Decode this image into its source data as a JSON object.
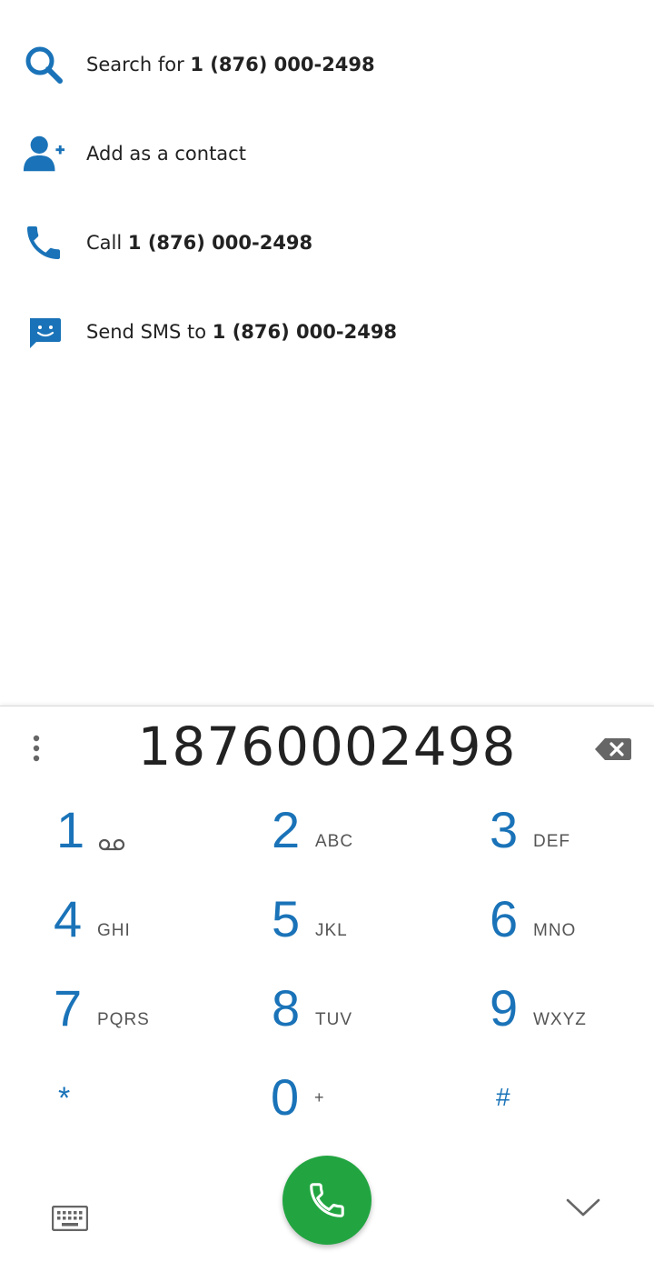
{
  "suggestions": {
    "search": {
      "prefix": "Search for ",
      "number": "1 (876) 000-2498"
    },
    "add_contact": {
      "label": "Add as a contact"
    },
    "call": {
      "prefix": "Call ",
      "number": "1 (876) 000-2498"
    },
    "sms": {
      "prefix": "Send SMS to ",
      "number": "1 (876) 000-2498"
    }
  },
  "dialpad": {
    "digits": "18760002498",
    "keys": [
      {
        "num": "1",
        "letters": ""
      },
      {
        "num": "2",
        "letters": "ABC"
      },
      {
        "num": "3",
        "letters": "DEF"
      },
      {
        "num": "4",
        "letters": "GHI"
      },
      {
        "num": "5",
        "letters": "JKL"
      },
      {
        "num": "6",
        "letters": "MNO"
      },
      {
        "num": "7",
        "letters": "PQRS"
      },
      {
        "num": "8",
        "letters": "TUV"
      },
      {
        "num": "9",
        "letters": "WXYZ"
      },
      {
        "num": "*",
        "letters": ""
      },
      {
        "num": "0",
        "letters": "+"
      },
      {
        "num": "#",
        "letters": ""
      }
    ]
  },
  "colors": {
    "accent": "#1a73b8",
    "call_button": "#22a541",
    "text": "#222222",
    "letters": "#555555"
  },
  "icons": {
    "search": "search-icon",
    "add_contact": "add-person-icon",
    "call": "phone-icon",
    "sms": "message-icon",
    "more": "more-vert-icon",
    "backspace": "backspace-icon",
    "voicemail": "voicemail-icon",
    "keyboard": "keyboard-icon",
    "collapse": "chevron-down-icon",
    "dial": "phone-icon"
  }
}
